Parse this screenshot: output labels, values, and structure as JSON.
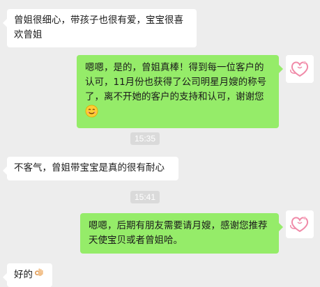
{
  "messages": [
    {
      "from": "other",
      "text": "曾姐很细心，带孩子也很有爱，宝宝很喜欢曾姐"
    },
    {
      "from": "self",
      "text": "嗯嗯，是的，曾姐真棒！得到每一位客户的认可，11月份也获得了公司明星月嫂的称号了，离不开她的客户的支持和认可，谢谢您",
      "emoji": "smiling-face"
    },
    {
      "type": "time",
      "text": "15:35"
    },
    {
      "from": "other",
      "text": "不客气，曾姐带宝宝是真的很有耐心"
    },
    {
      "type": "time",
      "text": "15:41"
    },
    {
      "from": "self",
      "text": "嗯嗯，后期有朋友需要请月嫂，感谢您推荐天使宝贝或者曾姐哈。"
    },
    {
      "from": "other",
      "text": "好的",
      "emoji": "ok-hand"
    }
  ],
  "colors": {
    "background": "#ededed",
    "incoming_bubble": "#ffffff",
    "outgoing_bubble": "#95ec69",
    "time_badge": "#dadada"
  },
  "avatar_icon": "pink-heart-logo"
}
